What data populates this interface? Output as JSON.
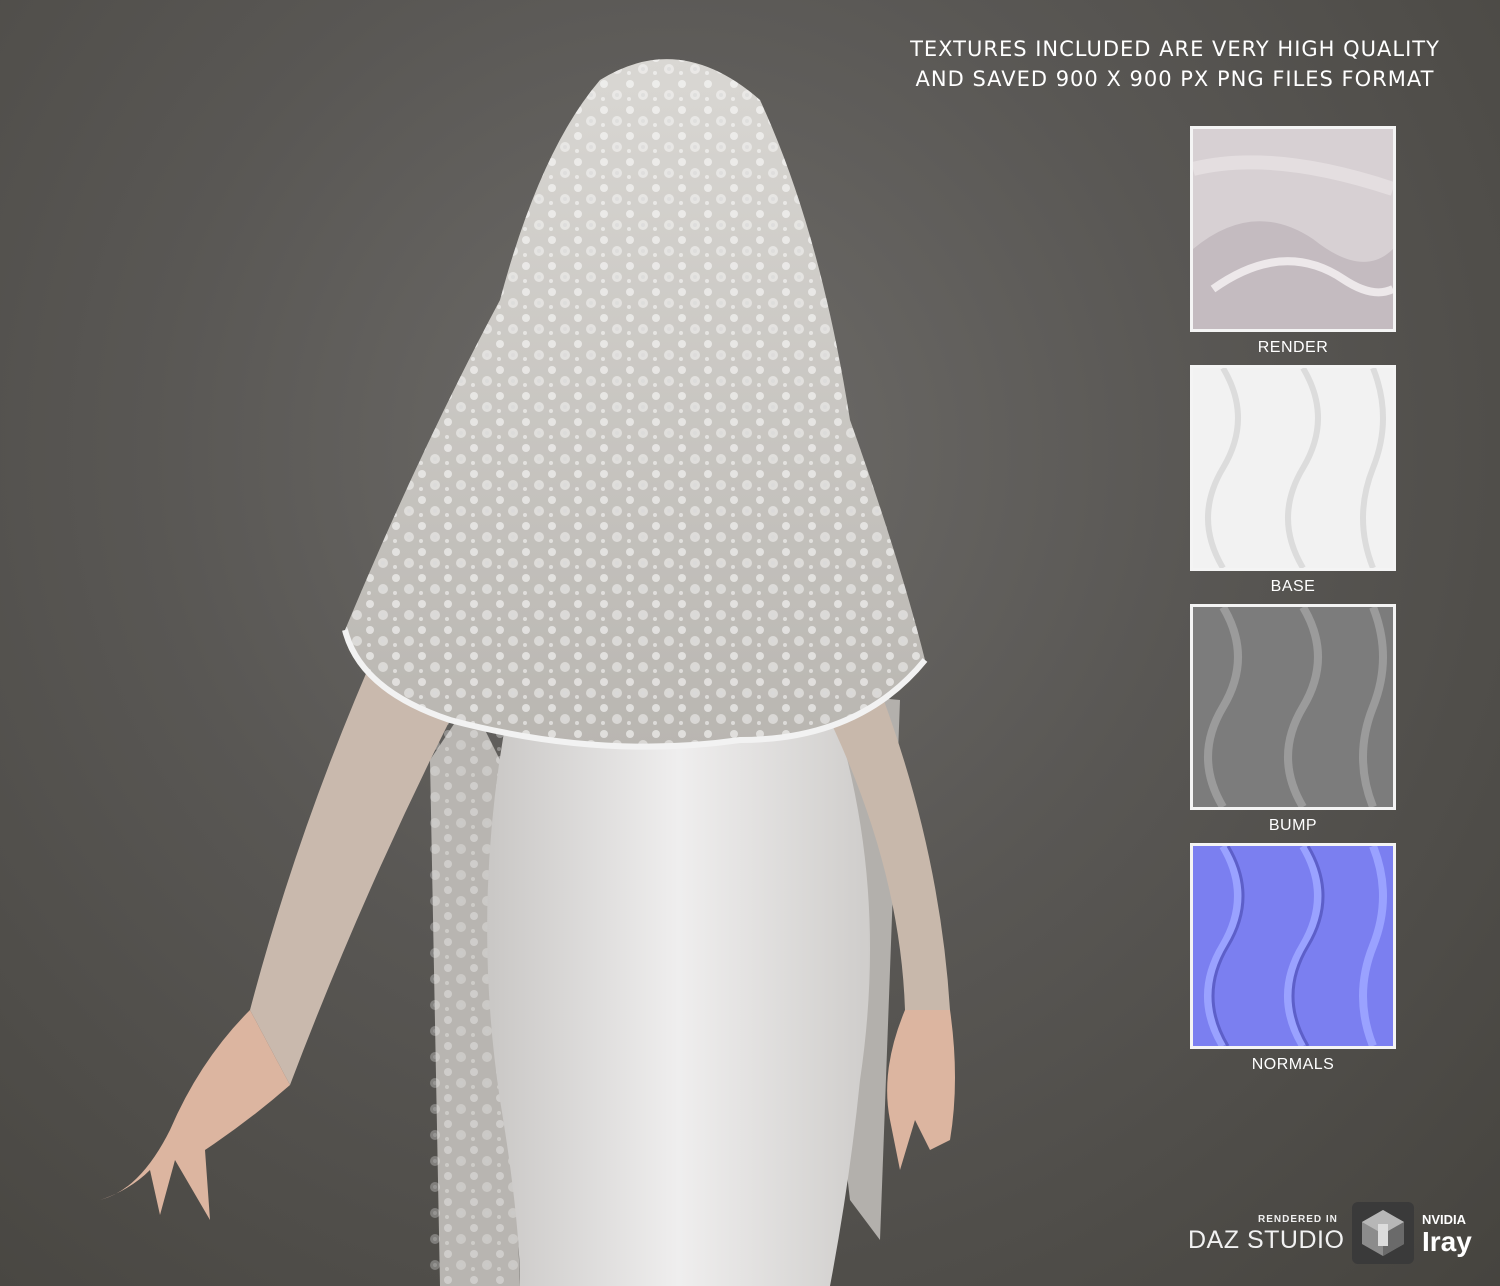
{
  "headline": {
    "line1": "TEXTURES INCLUDED ARE VERY HIGH QUALITY",
    "line2": "AND SAVED 900 X 900 PX PNG FILES FORMAT"
  },
  "swatches": [
    {
      "label": "RENDER",
      "icon": "render-swatch"
    },
    {
      "label": "BASE",
      "icon": "base-swatch"
    },
    {
      "label": "BUMP",
      "icon": "bump-swatch"
    },
    {
      "label": "NORMALS",
      "icon": "normals-swatch"
    }
  ],
  "badge": {
    "rendered_in": "RENDERED IN",
    "daz_studio": "DAZ STUDIO",
    "nvidia": "NVIDIA",
    "iray": "Iray",
    "icon": "daz-cube-logo"
  },
  "colors": {
    "background": "#595754",
    "text": "#ffffff",
    "normals_blue": "#7b7ff0"
  }
}
